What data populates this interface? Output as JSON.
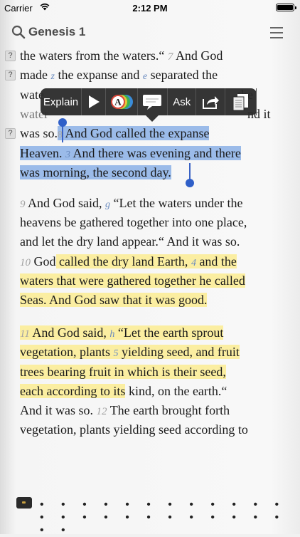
{
  "status": {
    "carrier": "Carrier",
    "time": "2:12 PM"
  },
  "nav": {
    "title": "Genesis 1"
  },
  "popup": {
    "explain": "Explain",
    "ask": "Ask"
  },
  "text": {
    "l1a": "the waters from the waters.“",
    "l1v": "7",
    "l1b": "And God",
    "l2a": "made",
    "l2r1": "z",
    "l2b": "the expanse and",
    "l2r2": "e",
    "l2c": "separated the",
    "l3a": "wate",
    "l3b": "the",
    "l4a": "water",
    "l4b": "nd it",
    "l5a": "was so.",
    "l5v": "8",
    "l5b": "And God called the expanse",
    "l6a": "Heaven.",
    "l6r": "3",
    "l6b": "And there was evening and there",
    "l7a": "was morning, the second day.",
    "l8v": "9",
    "l8a": "And God said,",
    "l8r": "g",
    "l8b": "“Let the waters under the",
    "l9": "heavens be gathered together into one place,",
    "l10": "and let the dry land appear.“ And it was so.",
    "l11v": "10",
    "l11a": "God",
    "l11b": "called the dry land Earth,",
    "l11r": "4",
    "l11c": "and the",
    "l12": "waters that were gathered together he called",
    "l13": "Seas. And God saw that it was good.",
    "l14v": "11",
    "l14a": "And God said,",
    "l14r": "h",
    "l14b": "“Let the earth sprout",
    "l15a": "vegetation, plants",
    "l15r": "5",
    "l15b": "yielding seed, and fruit",
    "l16": "trees bearing fruit in which is their seed,",
    "l17a": "each according to its",
    "l17b": "kind, on the earth.“",
    "l18a": "And it was so.",
    "l18v": "12",
    "l18b": "The earth brought forth",
    "l19": "vegetation, plants yielding seed according to"
  },
  "icons": {
    "search": "search-icon",
    "menu": "hamburger-menu-icon",
    "play": "play-icon",
    "color": "highlight-color-icon",
    "note": "note-icon",
    "share": "share-icon",
    "copy": "copy-icon",
    "help": "question-icon",
    "library": "library-icon"
  },
  "colors": {
    "selection": "#9bbbe9",
    "highlight": "#fbeea1",
    "popup": "#2a2a2a",
    "reference": "#6a8bbf"
  },
  "help_mark": "?",
  "bottom": {
    "dots": "• • • • • • • • • • • • • • • • • • • • • • • • • •"
  }
}
